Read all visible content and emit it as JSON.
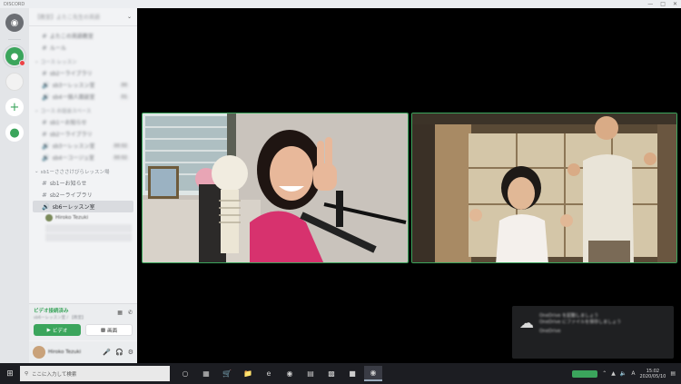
{
  "window": {
    "title": "DISCORD"
  },
  "server": {
    "name": "【教室】よたこ先生の英語"
  },
  "sidebar": {
    "top_channels": [
      {
        "label": "よたこの英語教室",
        "blurred": true
      },
      {
        "label": "ルール",
        "blurred": true
      }
    ],
    "categories": [
      {
        "title": "コース·レッスン",
        "blurred": true,
        "channels": [
          {
            "label": "sb2ーライブラリ",
            "count": "",
            "blurred": true
          },
          {
            "label": "sb3ーレッスン室",
            "count": "00",
            "blurred": true
          },
          {
            "label": "sb4ー個人面談室",
            "count": "01",
            "blurred": true
          }
        ]
      },
      {
        "title": "コース·お話会スペース",
        "blurred": true,
        "channels": [
          {
            "label": "sb1ーお知らせ",
            "count": "",
            "blurred": true
          },
          {
            "label": "sb2ーライブラリ",
            "count": "",
            "blurred": true
          },
          {
            "label": "sb3ーレッスン室",
            "count": "00 02",
            "blurred": true
          },
          {
            "label": "sb4ーコージュ室",
            "count": "00 02",
            "blurred": true
          }
        ]
      }
    ],
    "active_category": {
      "title": "sb1ーさささけびらレッスン場",
      "channels": [
        {
          "label": "sb1ーお知らせ"
        },
        {
          "label": "sb2ーライブラリ"
        },
        {
          "label": "sb6ーレッスン室",
          "selected": true
        }
      ],
      "voice_members": [
        "Hiroko Tezuki"
      ]
    }
  },
  "voice_panel": {
    "status": "ビデオ接続済み",
    "sub": "sb6ーレッスン室 / 【教室】",
    "video_label": "ビデオ",
    "screen_label": "画面"
  },
  "user": {
    "name": "Hiroko Tezuki",
    "tag": "#0000"
  },
  "notification": {
    "title": "OneDrive を起動しましょう",
    "body": "OneDrive にファイルを保存しましょう",
    "app": "OneDrive"
  },
  "taskbar": {
    "search_placeholder": "ここに入力して検索",
    "time": "15:02",
    "date": "2020/05/10"
  },
  "colors": {
    "accent": "#3ba55c",
    "stage_bg": "#000000",
    "sidebar_bg": "#f2f3f5"
  }
}
